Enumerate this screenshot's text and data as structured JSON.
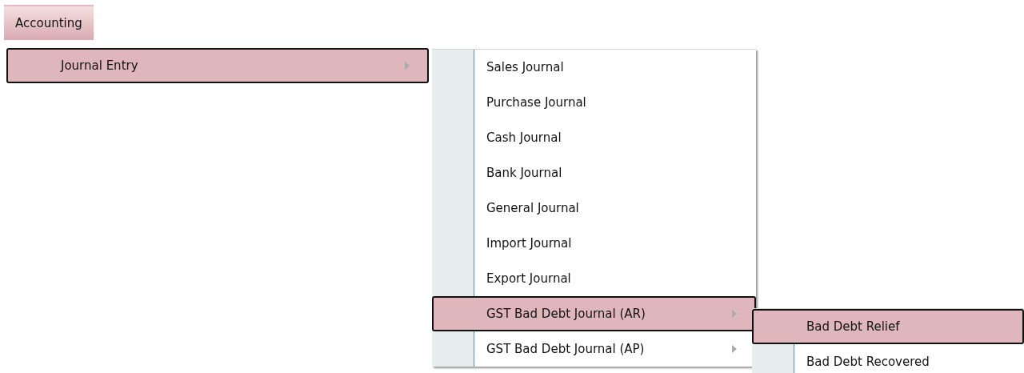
{
  "menubar": [
    {
      "label": "Accounting",
      "selected": true
    }
  ],
  "menus": [
    {
      "items": [
        {
          "label": "Journal Entry",
          "selected": true,
          "has_submenu": true
        }
      ]
    },
    {
      "items": [
        {
          "label": "Sales Journal",
          "selected": false,
          "has_submenu": false
        },
        {
          "label": "Purchase Journal",
          "selected": false,
          "has_submenu": false
        },
        {
          "label": "Cash Journal",
          "selected": false,
          "has_submenu": false
        },
        {
          "label": "Bank Journal",
          "selected": false,
          "has_submenu": false
        },
        {
          "label": "General Journal",
          "selected": false,
          "has_submenu": false
        },
        {
          "label": "Import Journal",
          "selected": false,
          "has_submenu": false
        },
        {
          "label": "Export Journal",
          "selected": false,
          "has_submenu": false
        },
        {
          "label": "GST Bad Debt Journal (AR)",
          "selected": true,
          "has_submenu": true
        },
        {
          "label": "GST Bad Debt Journal (AP)",
          "selected": false,
          "has_submenu": true
        }
      ]
    },
    {
      "items": [
        {
          "label": "Bad Debt Relief",
          "selected": true,
          "has_submenu": false
        },
        {
          "label": "Bad Debt Recovered",
          "selected": false,
          "has_submenu": false
        }
      ]
    }
  ]
}
